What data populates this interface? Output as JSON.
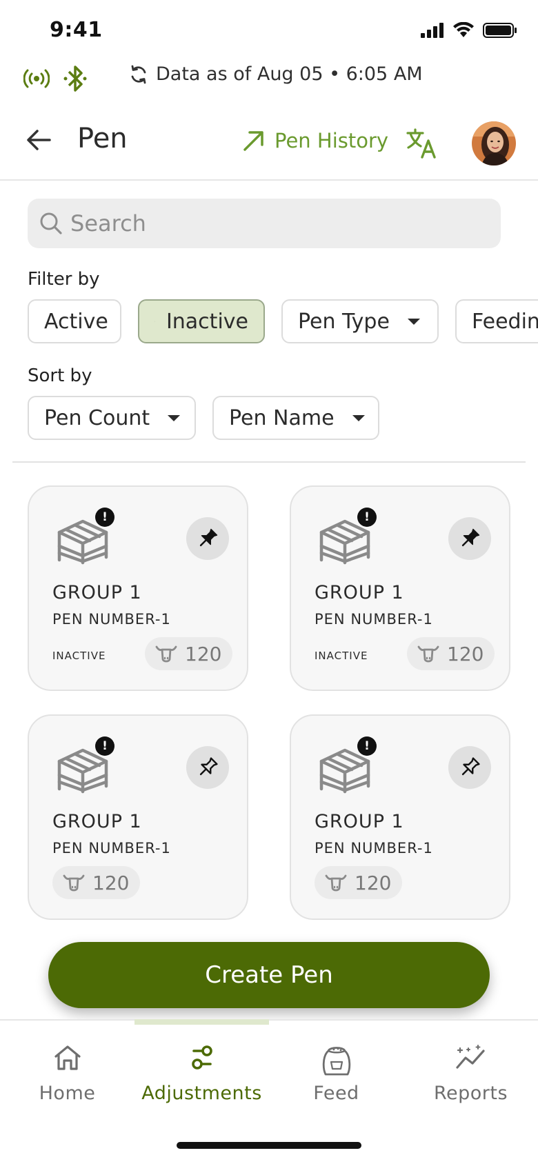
{
  "status_bar": {
    "time": "9:41"
  },
  "sync": {
    "text": "Data as of Aug 05 • 6:05 AM"
  },
  "header": {
    "title": "Pen",
    "history_label": "Pen History"
  },
  "search": {
    "placeholder": "Search"
  },
  "filter": {
    "label": "Filter by",
    "chips": [
      {
        "label": "Active",
        "selected": false
      },
      {
        "label": "Inactive",
        "selected": true
      },
      {
        "label": "Pen Type",
        "dropdown": true
      },
      {
        "label": "Feedin",
        "dropdown": false
      }
    ]
  },
  "sort": {
    "label": "Sort by",
    "chips": [
      {
        "label": "Pen Count",
        "dropdown": true
      },
      {
        "label": "Pen Name",
        "dropdown": true
      }
    ]
  },
  "cards": [
    {
      "group": "GROUP 1",
      "pen": "PEN NUMBER-1",
      "status": "INACTIVE",
      "count": "120",
      "pinned": true,
      "alert": "!"
    },
    {
      "group": "GROUP 1",
      "pen": "PEN NUMBER-1",
      "status": "INACTIVE",
      "count": "120",
      "pinned": true,
      "alert": "!"
    },
    {
      "group": "GROUP 1",
      "pen": "PEN NUMBER-1",
      "status": "",
      "count": "120",
      "pinned": false,
      "alert": "!"
    },
    {
      "group": "GROUP 1",
      "pen": "PEN NUMBER-1",
      "status": "",
      "count": "120",
      "pinned": false,
      "alert": "!"
    }
  ],
  "create_button": {
    "label": "Create Pen"
  },
  "nav": {
    "active": "Adjustments",
    "items": [
      {
        "label": "Home",
        "icon": "home-icon"
      },
      {
        "label": "Adjustments",
        "icon": "adjustments-icon"
      },
      {
        "label": "Feed",
        "icon": "feed-bag-icon"
      },
      {
        "label": "Reports",
        "icon": "reports-icon"
      }
    ]
  },
  "colors": {
    "accent": "#4c6a05",
    "accent_light": "#6a9a2e",
    "selected_chip": "#dfe8cd",
    "card_bg": "#f7f7f7"
  }
}
